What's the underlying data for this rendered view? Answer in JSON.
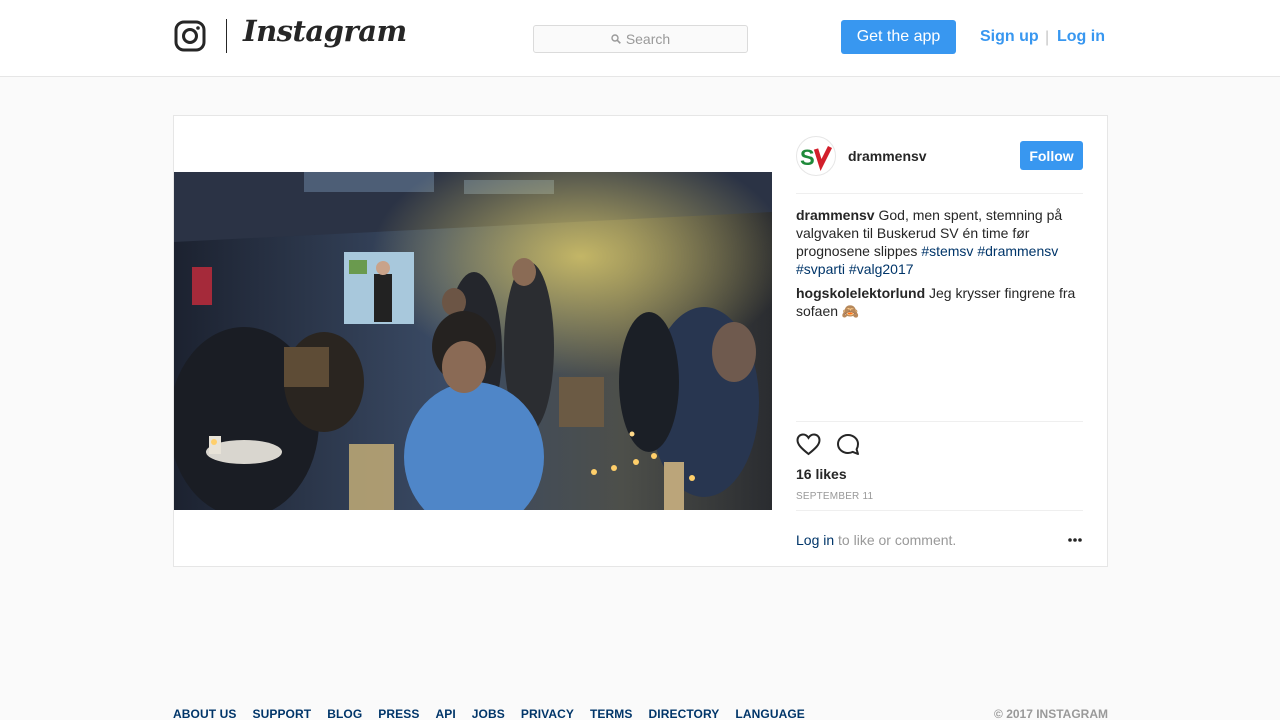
{
  "header": {
    "brand": "Instagram",
    "search_placeholder": "Search",
    "get_app_label": "Get the app",
    "signup_label": "Sign up",
    "separator": "|",
    "login_label": "Log in"
  },
  "post": {
    "author": "drammensv",
    "avatar_text": "SV",
    "follow_label": "Follow",
    "caption": {
      "user": "drammensv",
      "text": "God, men spent, stemning på valgvaken til Buskerud SV én time før prognosene slippes",
      "tags": [
        "#stemsv",
        "#drammensv",
        "#svparti",
        "#valg2017"
      ]
    },
    "comments": [
      {
        "user": "hogskolelektorlund",
        "text": "Jeg krysser fingrene fra sofaen 🙈"
      }
    ],
    "likes": "16 likes",
    "date": "SEPTEMBER 11",
    "login_prompt": {
      "link": "Log in",
      "rest": "to like or comment."
    },
    "icons": [
      "heart-icon",
      "comment-icon",
      "more-icon"
    ]
  },
  "footer": {
    "links": [
      "ABOUT US",
      "SUPPORT",
      "BLOG",
      "PRESS",
      "API",
      "JOBS",
      "PRIVACY",
      "TERMS",
      "DIRECTORY",
      "LANGUAGE"
    ],
    "copyright": "© 2017 INSTAGRAM"
  },
  "colors": {
    "accent": "#3897f0",
    "link_dark": "#003569",
    "muted": "#999999",
    "sv_green": "#1f8a3a",
    "sv_red": "#d21f2b"
  }
}
